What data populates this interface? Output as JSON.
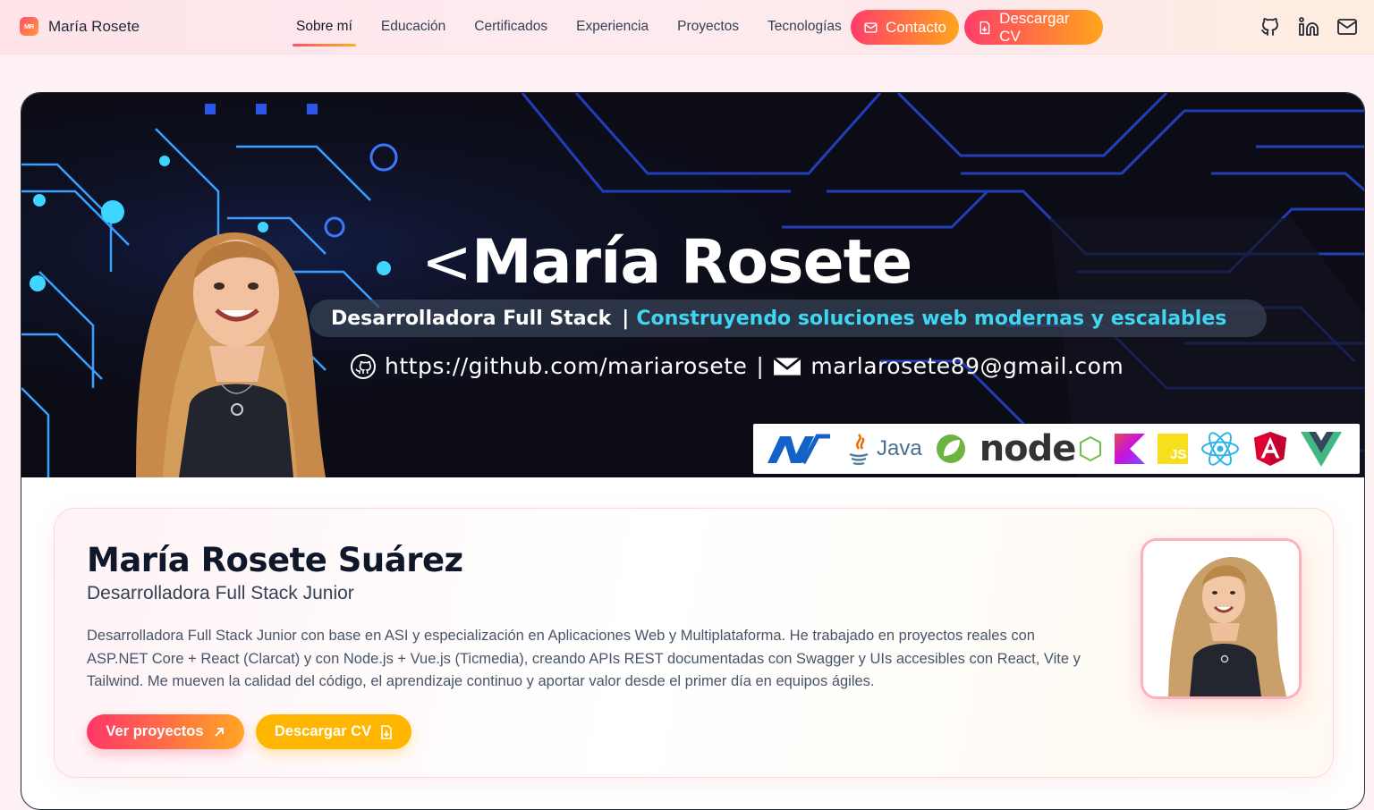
{
  "nav": {
    "brand_initials": "MR",
    "brand_name": "María Rosete",
    "links": [
      "Sobre mí",
      "Educación",
      "Certificados",
      "Experiencia",
      "Proyectos",
      "Tecnologías"
    ],
    "active_link": "Sobre mí",
    "contact_label": "Contacto",
    "cv_label": "Descargar CV",
    "icons": [
      "github-icon",
      "linkedin-icon",
      "mail-icon"
    ]
  },
  "banner": {
    "title": "María Rosete",
    "role": "Desarrolladora Full Stack",
    "separator": "|",
    "tagline": "Construyendo soluciones web modernas y escalables",
    "github": "https://github.com/mariarosete",
    "contact_sep": "|",
    "email": "marlarosete89@gmail.com",
    "tech_logos": [
      "dotnet-logo",
      "java-logo",
      "spring-logo",
      "nodejs-logo",
      "kotlin-logo",
      "javascript-logo",
      "react-logo",
      "angular-logo",
      "vue-logo"
    ],
    "java_text": "Java",
    "node_text": "node",
    "js_text": "JS"
  },
  "profile": {
    "name": "María Rosete Suárez",
    "role": "Desarrolladora Full Stack Junior",
    "bio": "Desarrolladora Full Stack Junior con base en ASI y especialización en Aplicaciones Web y Multiplataforma. He trabajado en proyectos reales con ASP.NET Core + React (Clarcat) y con Node.js + Vue.js (Ticmedia), creando APIs REST documentadas con Swagger y UIs accesibles con React, Vite y Tailwind. Me mueven la calidad del código, el aprendizaje continuo y aportar valor desde el primer día en equipos ágiles.",
    "btn_projects": "Ver proyectos",
    "btn_cv": "Descargar CV"
  },
  "colors": {
    "accent_pink": "#ff3d6a",
    "accent_orange": "#ffa51d",
    "accent_yellow": "#ffb600",
    "banner_cyan": "#3fd6f2"
  }
}
